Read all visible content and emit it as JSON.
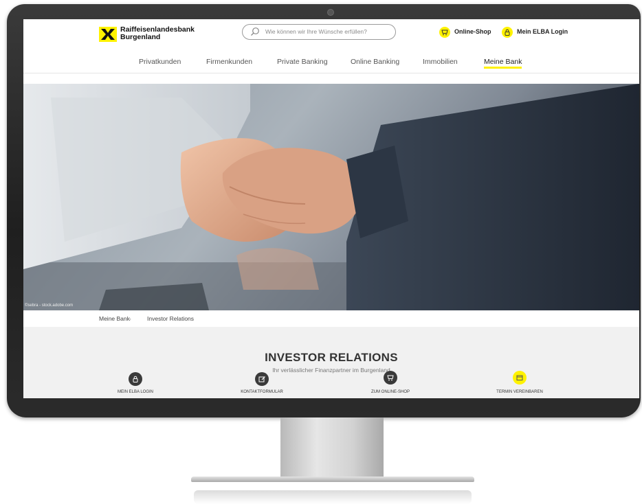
{
  "header": {
    "bank_name_line1": "Raiffeisenlandesbank",
    "bank_name_line2": "Burgenland",
    "search_placeholder": "Wie können wir Ihre Wünsche erfüllen?",
    "online_shop_label": "Online-Shop",
    "login_label": "Mein ELBA Login"
  },
  "nav": {
    "items": [
      {
        "label": "Privatkunden"
      },
      {
        "label": "Firmenkunden"
      },
      {
        "label": "Private Banking"
      },
      {
        "label": "Online Banking"
      },
      {
        "label": "Immobilien"
      },
      {
        "label": "Meine Bank"
      }
    ],
    "active": "Meine Bank"
  },
  "hero": {
    "credit": "©sebra - stock.adobe.com"
  },
  "breadcrumb": {
    "items": [
      "Meine Bank",
      "Investor Relations"
    ],
    "separator": "›"
  },
  "page": {
    "title": "INVESTOR RELATIONS",
    "subtitle": "Ihr verlässlicher Finanzpartner im Burgenland"
  },
  "quick_links": [
    {
      "label": "MEIN ELBA LOGIN",
      "icon": "lock-icon"
    },
    {
      "label": "KONTAKTFORMULAR",
      "icon": "edit-icon"
    },
    {
      "label": "ZUM ONLINE-SHOP",
      "icon": "cart-icon"
    },
    {
      "label": "TERMIN VEREINBAREN",
      "icon": "calendar-icon"
    }
  ],
  "colors": {
    "brand_yellow": "#fff200",
    "bezel": "#2a2a2a",
    "text_dark": "#333333"
  }
}
